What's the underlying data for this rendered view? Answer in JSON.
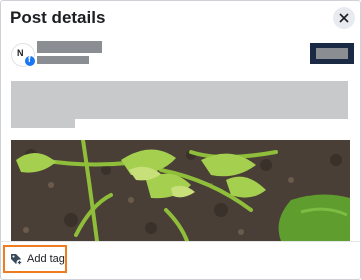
{
  "header": {
    "title": "Post details",
    "close_icon": "close-icon"
  },
  "author": {
    "avatar_initial": "N",
    "platform_badge_letter": "f",
    "platform_icon": "facebook-icon",
    "platform_color": "#1877f2"
  },
  "footer": {
    "add_tag_label": "Add tag",
    "add_tag_icon": "tag-plus-icon",
    "highlight_color": "#f07c22"
  },
  "colors": {
    "action_button": "#1b2a44"
  }
}
